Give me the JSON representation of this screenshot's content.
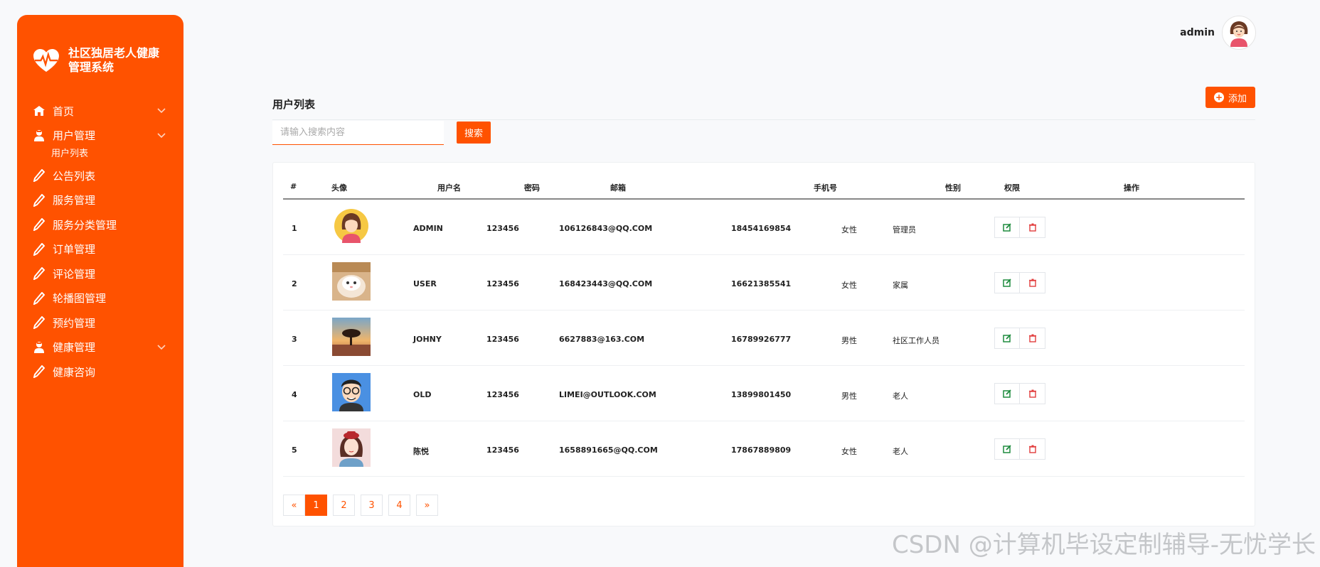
{
  "brand": {
    "title": "社区独居老人健康管理系统",
    "logo_icon": "heart-pulse-icon"
  },
  "colors": {
    "accent": "#ff5200",
    "edit": "#1e8b3e",
    "delete": "#e23d3d"
  },
  "sidebar": {
    "items": [
      {
        "label": "首页",
        "icon": "home-icon",
        "expandable": true
      },
      {
        "label": "用户管理",
        "icon": "user-icon",
        "expandable": true,
        "sub": [
          "用户列表"
        ]
      },
      {
        "label": "公告列表",
        "icon": "pen-icon"
      },
      {
        "label": "服务管理",
        "icon": "pen-icon"
      },
      {
        "label": "服务分类管理",
        "icon": "pen-icon"
      },
      {
        "label": "订单管理",
        "icon": "pen-icon"
      },
      {
        "label": "评论管理",
        "icon": "pen-icon"
      },
      {
        "label": "轮播图管理",
        "icon": "pen-icon"
      },
      {
        "label": "预约管理",
        "icon": "pen-icon"
      },
      {
        "label": "健康管理",
        "icon": "user-icon",
        "expandable": true
      },
      {
        "label": "健康咨询",
        "icon": "pen-icon"
      }
    ]
  },
  "header": {
    "username": "admin"
  },
  "main": {
    "title": "用户列表",
    "add_label": "添加",
    "search_placeholder": "请输入搜索内容",
    "search_label": "搜索",
    "columns": [
      "#",
      "头像",
      "用户名",
      "密码",
      "邮箱",
      "手机号",
      "性别",
      "权限",
      "操作"
    ],
    "rows": [
      {
        "id": "1",
        "username": "ADMIN",
        "password": "123456",
        "email": "106126843@QQ.COM",
        "phone": "18454169854",
        "gender": "女性",
        "role": "管理员"
      },
      {
        "id": "2",
        "username": "USER",
        "password": "123456",
        "email": "168423443@QQ.COM",
        "phone": "16621385541",
        "gender": "女性",
        "role": "家属"
      },
      {
        "id": "3",
        "username": "JOHNY",
        "password": "123456",
        "email": "6627883@163.COM",
        "phone": "16789926777",
        "gender": "男性",
        "role": "社区工作人员"
      },
      {
        "id": "4",
        "username": "OLD",
        "password": "123456",
        "email": "LIMEI@OUTLOOK.COM",
        "phone": "13899801450",
        "gender": "男性",
        "role": "老人"
      },
      {
        "id": "5",
        "username": "陈悦",
        "password": "123456",
        "email": "1658891665@QQ.COM",
        "phone": "17867889809",
        "gender": "女性",
        "role": "老人"
      }
    ],
    "pagination": {
      "prev": "«",
      "pages": [
        "1",
        "2",
        "3",
        "4"
      ],
      "next": "»",
      "current": "1"
    }
  },
  "watermark": "CSDN @计算机毕设定制辅导-无忧学长"
}
